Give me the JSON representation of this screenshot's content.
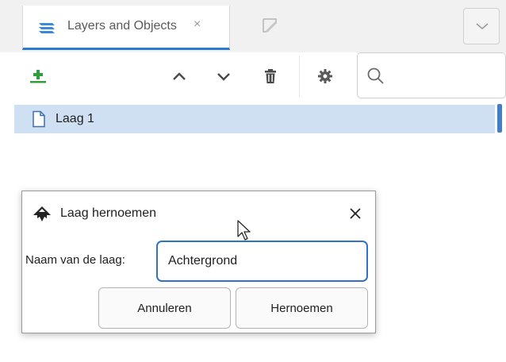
{
  "tabs": {
    "active_label": "Layers and Objects",
    "close_glyph": "×"
  },
  "toolbar": {
    "add_layer_icon": "add-layer-icon",
    "search": {
      "placeholder": "",
      "value": ""
    }
  },
  "layers": [
    {
      "name": "Laag 1",
      "selected": true
    }
  ],
  "dialog": {
    "title": "Laag hernoemen",
    "field_label": "Naam van de laag:",
    "field_value": "Achtergrond",
    "cancel_label": "Annuleren",
    "rename_label": "Hernoemen"
  },
  "colors": {
    "accent": "#2e7bd4",
    "selection": "#cfe0f3",
    "add_icon_green": "#2e9e3e"
  }
}
